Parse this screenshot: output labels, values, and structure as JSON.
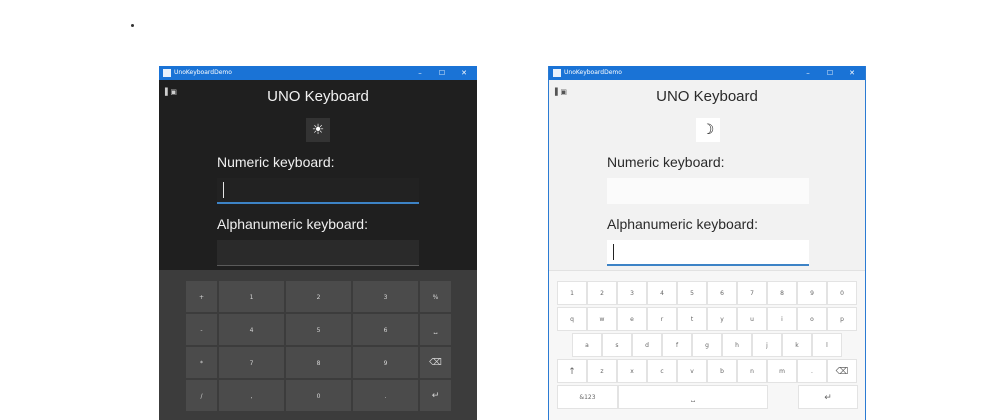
{
  "windows": {
    "dark": {
      "title": "UnoKeyboardDemo",
      "controls": {
        "min": "–",
        "max": "☐",
        "close": "✕"
      },
      "pane_icon": "▌▣",
      "app_title": "UNO Keyboard",
      "theme_toggle_icon": "☀",
      "numeric_label": "Numeric keyboard:",
      "alpha_label": "Alphanumeric keyboard:",
      "keyboard_rows": [
        [
          "+",
          "1",
          "2",
          "3",
          "%"
        ],
        [
          "-",
          "4",
          "5",
          "6",
          "⎵"
        ],
        [
          "*",
          "7",
          "8",
          "9",
          "⌫"
        ],
        [
          "/",
          ",",
          "0",
          ".",
          "↵"
        ]
      ]
    },
    "light": {
      "title": "UnoKeyboardDemo",
      "controls": {
        "min": "–",
        "max": "☐",
        "close": "✕"
      },
      "pane_icon": "▌▣",
      "app_title": "UNO Keyboard",
      "theme_toggle_icon": "☽",
      "numeric_label": "Numeric keyboard:",
      "alpha_label": "Alphanumeric keyboard:",
      "keyboard_rows": [
        [
          "1",
          "2",
          "3",
          "4",
          "5",
          "6",
          "7",
          "8",
          "9",
          "0"
        ],
        [
          "q",
          "w",
          "e",
          "r",
          "t",
          "y",
          "u",
          "i",
          "o",
          "p"
        ],
        [
          "a",
          "s",
          "d",
          "f",
          "g",
          "h",
          "j",
          "k",
          "l"
        ],
        [
          "↑",
          "z",
          "x",
          "c",
          "v",
          "b",
          "n",
          "m",
          ".",
          "⌫"
        ],
        [
          "&123",
          "⎵",
          "↵"
        ]
      ]
    }
  }
}
